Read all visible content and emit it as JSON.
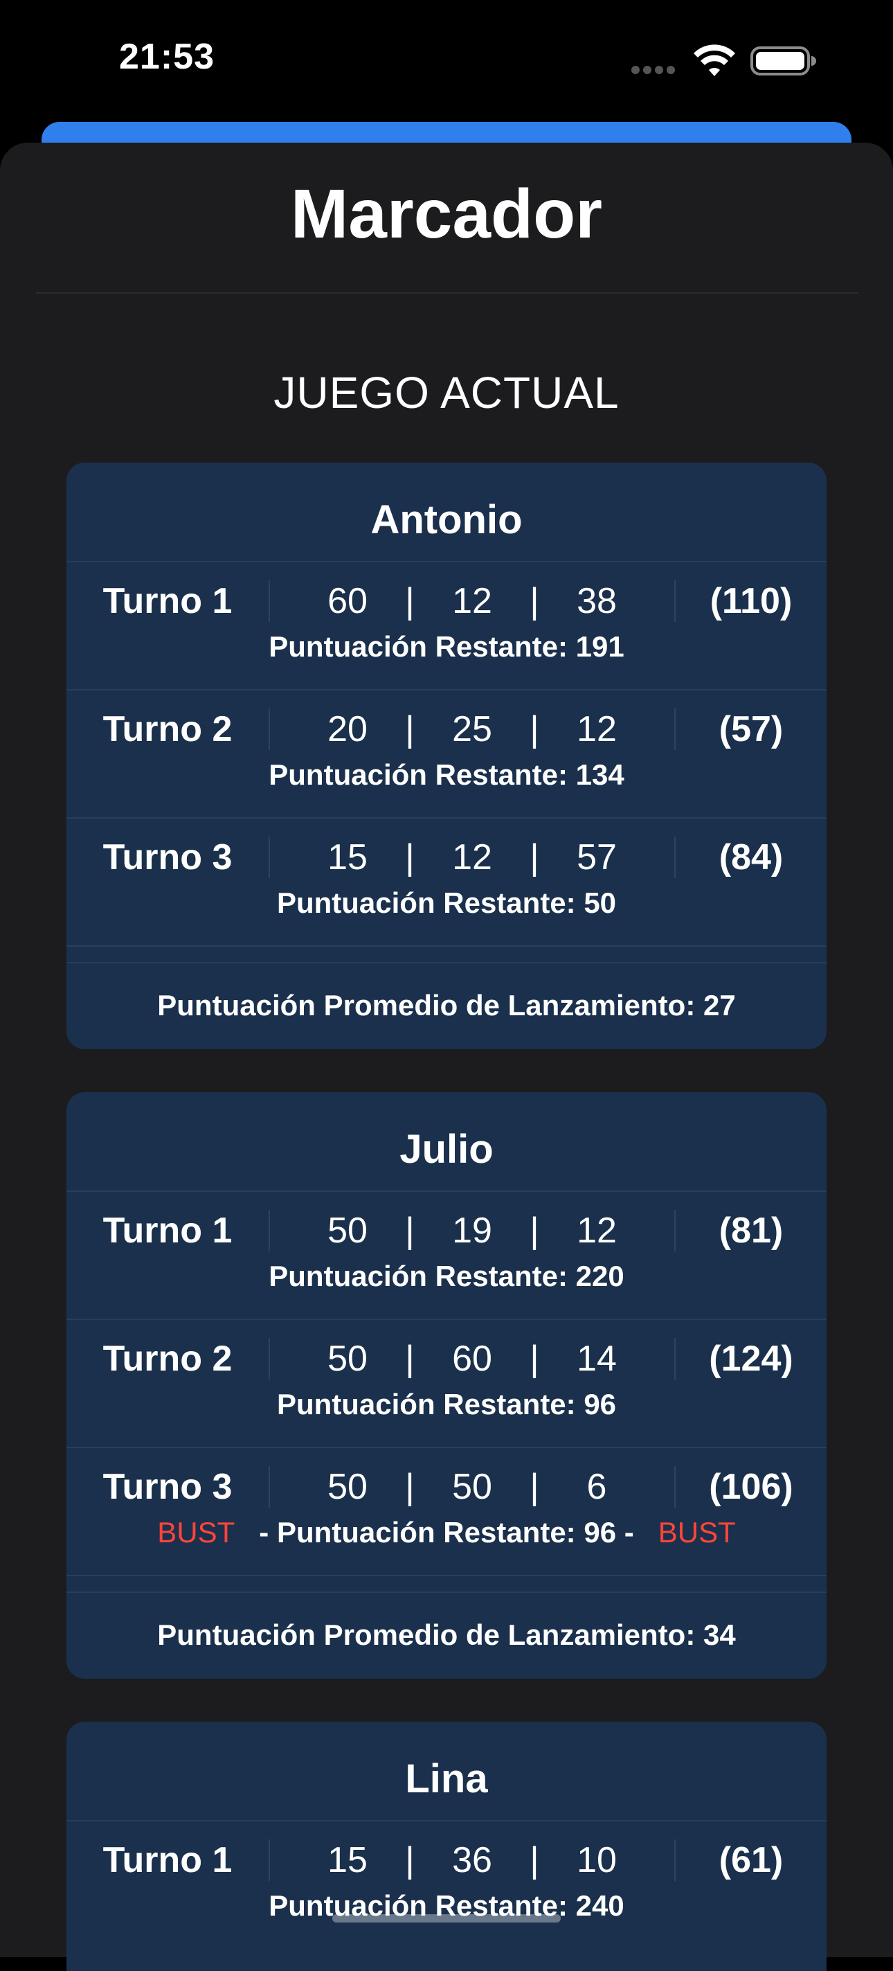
{
  "status_bar": {
    "time": "21:53"
  },
  "sheet": {
    "title": "Marcador",
    "section_header": "JUEGO ACTUAL"
  },
  "players": [
    {
      "name": "Antonio",
      "turns": [
        {
          "label": "Turno 1",
          "darts": [
            "60",
            "12",
            "38"
          ],
          "total": "(110)",
          "remaining": "Puntuación Restante: 191"
        },
        {
          "label": "Turno 2",
          "darts": [
            "20",
            "25",
            "12"
          ],
          "total": "(57)",
          "remaining": "Puntuación Restante: 134"
        },
        {
          "label": "Turno 3",
          "darts": [
            "15",
            "12",
            "57"
          ],
          "total": "(84)",
          "remaining": "Puntuación Restante: 50"
        }
      ],
      "average": "Puntuación Promedio de Lanzamiento: 27"
    },
    {
      "name": "Julio",
      "turns": [
        {
          "label": "Turno 1",
          "darts": [
            "50",
            "19",
            "12"
          ],
          "total": "(81)",
          "remaining": "Puntuación Restante: 220"
        },
        {
          "label": "Turno 2",
          "darts": [
            "50",
            "60",
            "14"
          ],
          "total": "(124)",
          "remaining": "Puntuación Restante: 96"
        },
        {
          "label": "Turno 3",
          "darts": [
            "50",
            "50",
            "6"
          ],
          "total": "(106)",
          "remaining": "- Puntuación Restante: 96 -",
          "bust_left": "BUST",
          "bust_right": "BUST"
        }
      ],
      "average": "Puntuación Promedio de Lanzamiento: 34"
    },
    {
      "name": "Lina",
      "turns": [
        {
          "label": "Turno 1",
          "darts": [
            "15",
            "36",
            "10"
          ],
          "total": "(61)",
          "remaining": "Puntuación Restante: 240"
        }
      ]
    }
  ],
  "separator": "|",
  "colors": {
    "background": "#1c1c1e",
    "card": "#1a304c",
    "accent": "#2f80ed",
    "bust": "#ff453a"
  }
}
